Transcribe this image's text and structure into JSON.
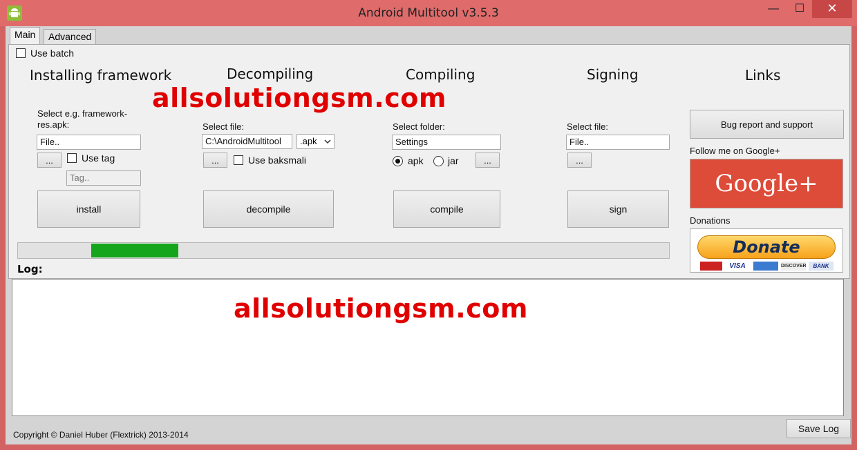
{
  "window": {
    "title": "Android Multitool v3.5.3",
    "controls": {
      "minimize": "—",
      "maximize": "☐",
      "close": "✕"
    }
  },
  "tabs": [
    {
      "label": "Main",
      "active": true
    },
    {
      "label": "Advanced",
      "active": false
    }
  ],
  "use_batch": {
    "label": "Use batch",
    "checked": false
  },
  "sections": {
    "framework": {
      "heading": "Installing framework",
      "select_label": "Select e.g. framework-res.apk:",
      "file_value": "File..",
      "browse_label": "...",
      "use_tag_label": "Use tag",
      "tag_placeholder": "Tag..",
      "action_label": "install"
    },
    "decompile": {
      "heading": "Decompiling",
      "select_label": "Select file:",
      "file_value": "C:\\AndroidMultitool",
      "ext_value": ".apk",
      "browse_label": "...",
      "baksmali_label": "Use baksmali",
      "action_label": "decompile"
    },
    "compile": {
      "heading": "Compiling",
      "select_label": "Select folder:",
      "folder_value": "Settings",
      "radio_apk": "apk",
      "radio_jar": "jar",
      "selected": "apk",
      "browse_label": "...",
      "action_label": "compile"
    },
    "sign": {
      "heading": "Signing",
      "select_label": "Select file:",
      "file_value": "File..",
      "browse_label": "...",
      "action_label": "sign"
    },
    "links": {
      "heading": "Links",
      "bug_report_label": "Bug report and support",
      "follow_label": "Follow me on Google+",
      "google_text": "Google+",
      "donations_label": "Donations",
      "donate_text": "Donate",
      "cards": [
        "MasterCard",
        "VISA",
        "AMEX",
        "DISCOVER",
        "BANK"
      ]
    }
  },
  "watermark": "allsolutiongsm.com",
  "progress": {
    "value": 0.134,
    "offset": 0.113
  },
  "log": {
    "label": "Log:"
  },
  "footer": {
    "copyright": "Copyright © Daniel Huber (Flextrick) 2013-2014",
    "save_log_label": "Save Log"
  },
  "colors": {
    "titlebar": "#df6b6b",
    "close_button": "#c74747",
    "progress_fill": "#14a51d",
    "watermark": "#e00000",
    "google": "#dd4b39"
  }
}
